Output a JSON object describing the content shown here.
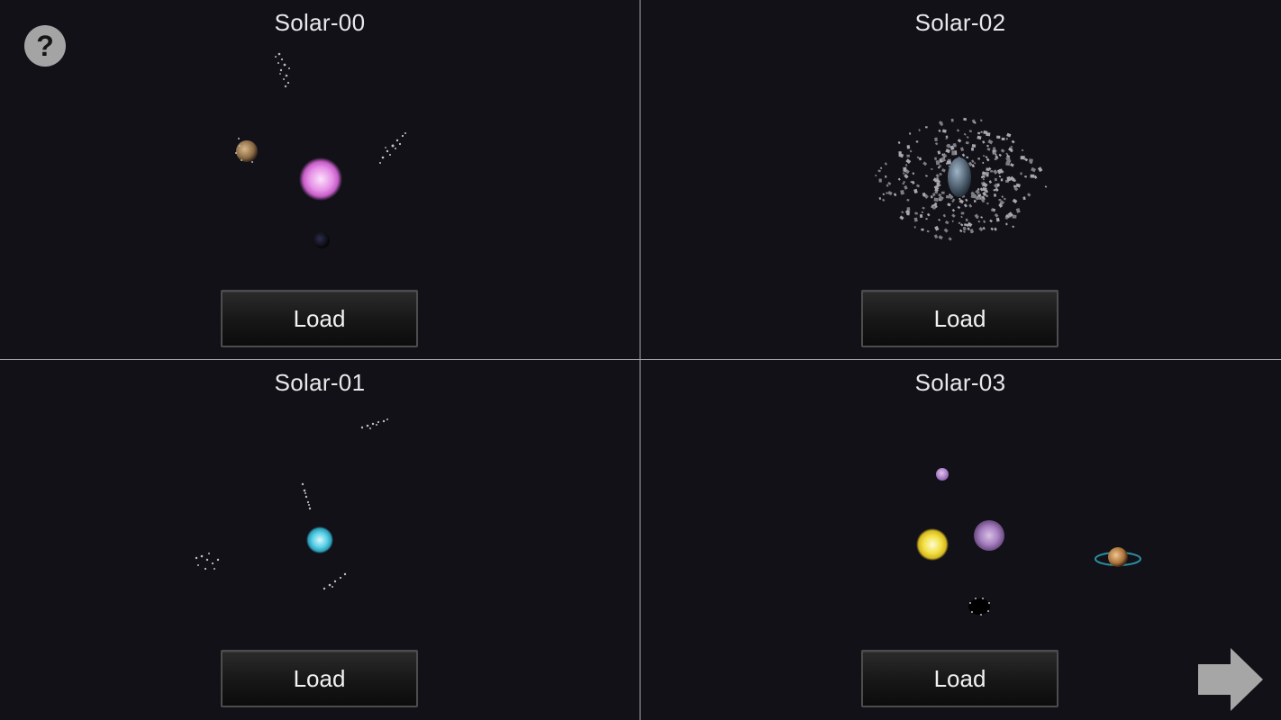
{
  "solars": [
    {
      "id": "solar-00",
      "title": "Solar-00",
      "load_label": "Load"
    },
    {
      "id": "solar-02",
      "title": "Solar-02",
      "load_label": "Load"
    },
    {
      "id": "solar-01",
      "title": "Solar-01",
      "load_label": "Load"
    },
    {
      "id": "solar-03",
      "title": "Solar-03",
      "load_label": "Load"
    }
  ],
  "help_button": {
    "label": "?",
    "icon": "question-mark-icon"
  },
  "next_button": {
    "icon": "right-arrow-icon"
  },
  "colors": {
    "background": "#121118",
    "divider": "#a9a9ad",
    "pink_star": "#e58fe6",
    "blue_star": "#5ad0e6",
    "yellow_star": "#f2e044",
    "violet_star": "#a77fc0"
  }
}
